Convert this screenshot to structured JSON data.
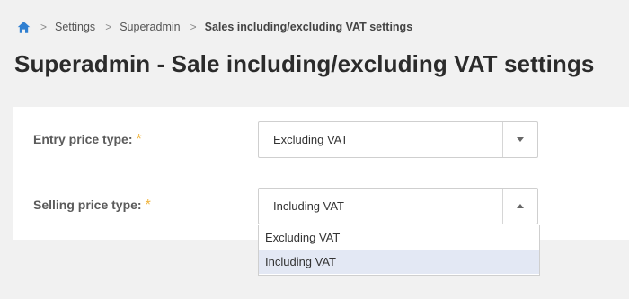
{
  "breadcrumb": {
    "home_icon": "home-icon",
    "items": [
      "Settings",
      "Superadmin",
      "Sales including/excluding VAT settings"
    ],
    "separator": ">"
  },
  "page": {
    "title": "Superadmin - Sale including/excluding VAT settings"
  },
  "form": {
    "entry_price": {
      "label": "Entry price type:",
      "required_mark": "*",
      "value": "Excluding VAT"
    },
    "selling_price": {
      "label": "Selling price type:",
      "required_mark": "*",
      "value": "Including VAT",
      "open": true,
      "options": [
        "Excluding VAT",
        "Including VAT"
      ],
      "highlighted": "Including VAT"
    }
  },
  "colors": {
    "accent": "#2f7fd1",
    "required": "#f0b43c",
    "option_highlight": "#e3e8f4"
  }
}
